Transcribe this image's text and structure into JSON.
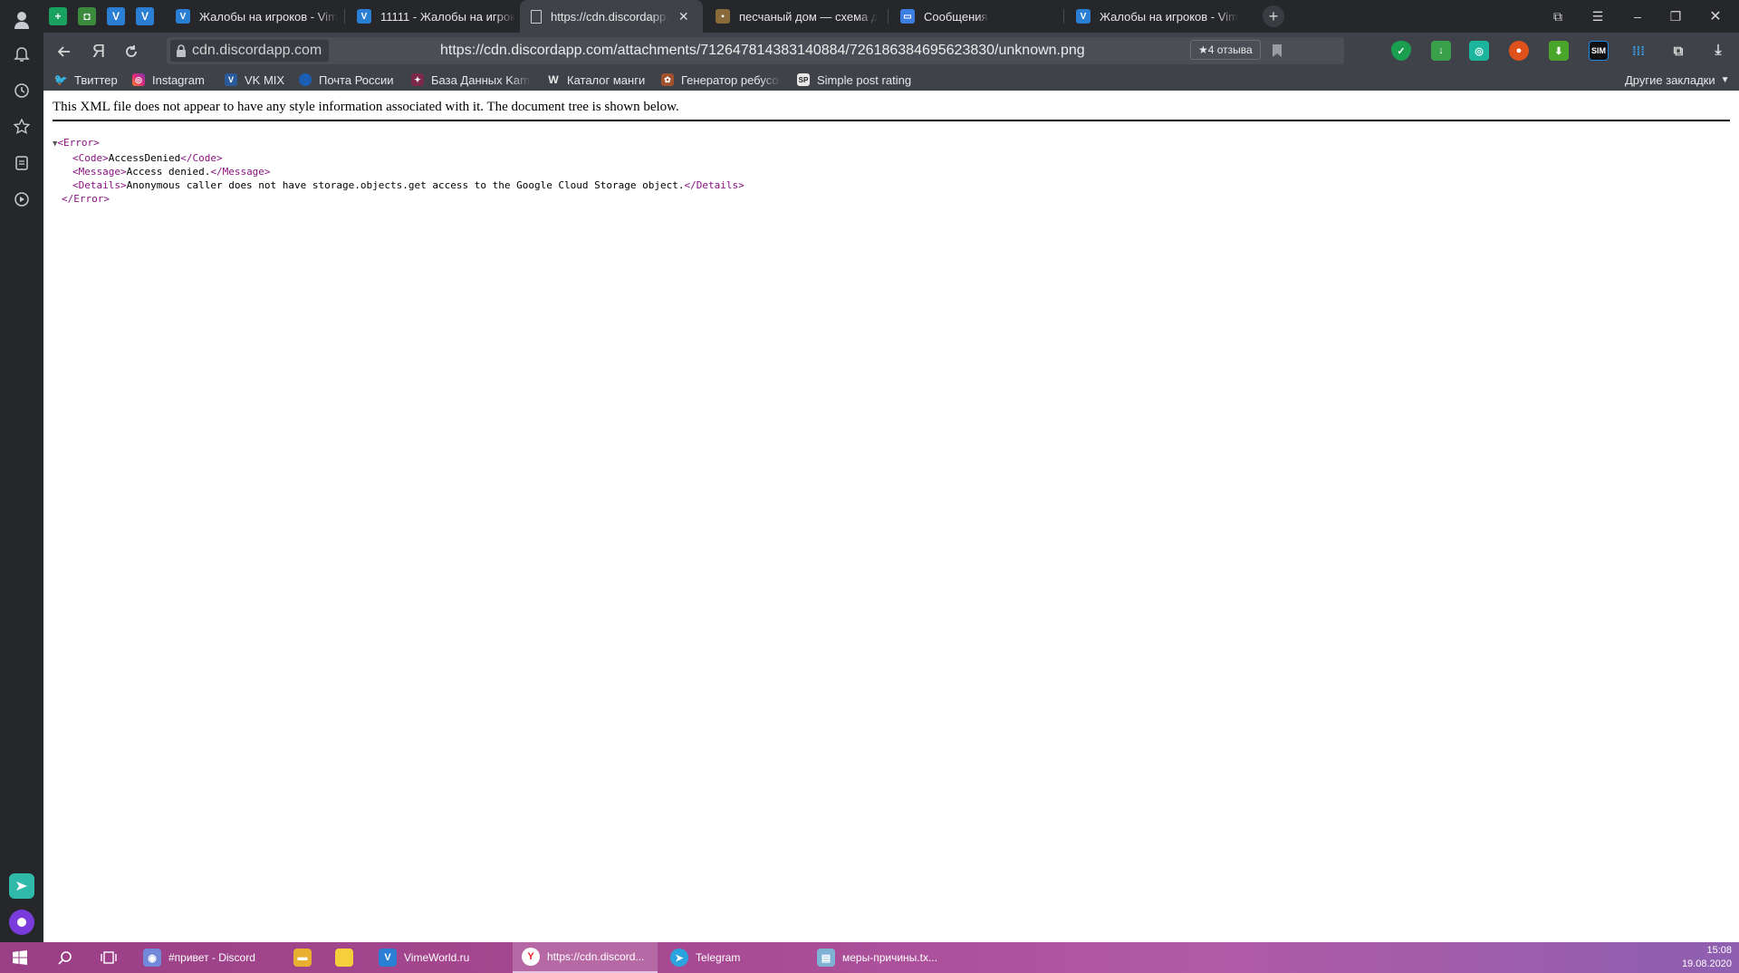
{
  "tabs": [
    {
      "label": "Жалобы на игроков - Vim",
      "active": false
    },
    {
      "label": "11111 - Жалобы на игрок",
      "active": false
    },
    {
      "label": "https://cdn.discordapp.",
      "active": true
    },
    {
      "label": "песчаный дом — схема д",
      "active": false
    },
    {
      "label": "Сообщения",
      "active": false
    },
    {
      "label": "Жалобы на игроков - Vim",
      "active": false
    }
  ],
  "toolbar": {
    "yandex_glyph": "Я",
    "host": "cdn.discordapp.com",
    "url": "https://cdn.discordapp.com/attachments/712647814383140884/726186384695623830/unknown.png",
    "reviews": "★4 отзыва"
  },
  "bookmarks": [
    {
      "label": "Твиттер"
    },
    {
      "label": "Instagram"
    },
    {
      "label": "VK MIX"
    },
    {
      "label": "Почта России"
    },
    {
      "label": "База Данных Kami"
    },
    {
      "label": "Каталог манги"
    },
    {
      "label": "Генератор ребусов"
    },
    {
      "label": "Simple post rating"
    },
    {
      "label": "Другие закладки"
    }
  ],
  "page": {
    "note": "This XML file does not appear to have any style information associated with it. The document tree is shown below.",
    "code": "AccessDenied",
    "message": "Access denied.",
    "details": "Anonymous caller does not have storage.objects.get access to the Google Cloud Storage object."
  },
  "taskbar": {
    "items": [
      {
        "label": "#привет - Discord"
      },
      {
        "label": "VimeWorld.ru"
      },
      {
        "label": "https://cdn.discord..."
      },
      {
        "label": "Telegram"
      },
      {
        "label": "меры-причины.tx..."
      }
    ],
    "time": "15:08",
    "date": "19.08.2020"
  },
  "colors": {
    "accent": "#881280",
    "taskbar": "#a84a93"
  }
}
